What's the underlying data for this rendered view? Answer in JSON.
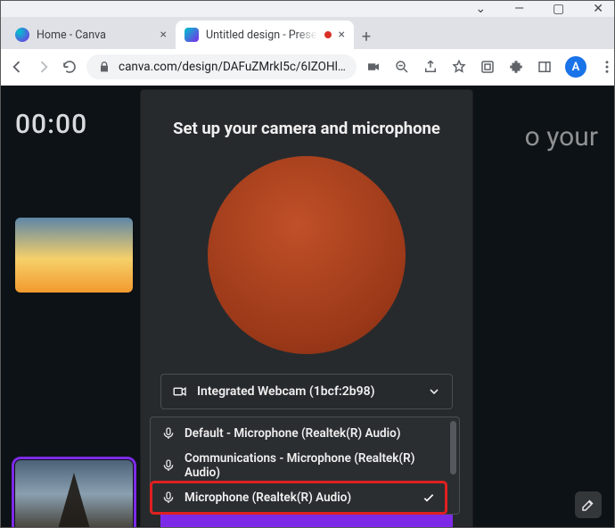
{
  "window": {
    "controls": {
      "min": "—",
      "max": "▢",
      "close": "✕",
      "expand": "⌄"
    }
  },
  "tabs": {
    "inactive": {
      "title": "Home - Canva"
    },
    "active": {
      "title": "Untitled design - Presen"
    },
    "newtab": "+"
  },
  "toolbar": {
    "url": "canva.com/design/DAFuZMrkI5c/6IZOHl…",
    "avatar_initial": "A"
  },
  "app": {
    "timer": "00:00",
    "bg_text_fragment": "o your"
  },
  "modal": {
    "title": "Set up your camera and microphone",
    "camera_select": "Integrated Webcam (1bcf:2b98)",
    "mic_options": [
      {
        "label": "Default - Microphone (Realtek(R) Audio)",
        "selected": false
      },
      {
        "label": "Communications - Microphone (Realtek(R) Audio)",
        "selected": false
      },
      {
        "label": "Microphone (Realtek(R) Audio)",
        "selected": true
      }
    ]
  }
}
